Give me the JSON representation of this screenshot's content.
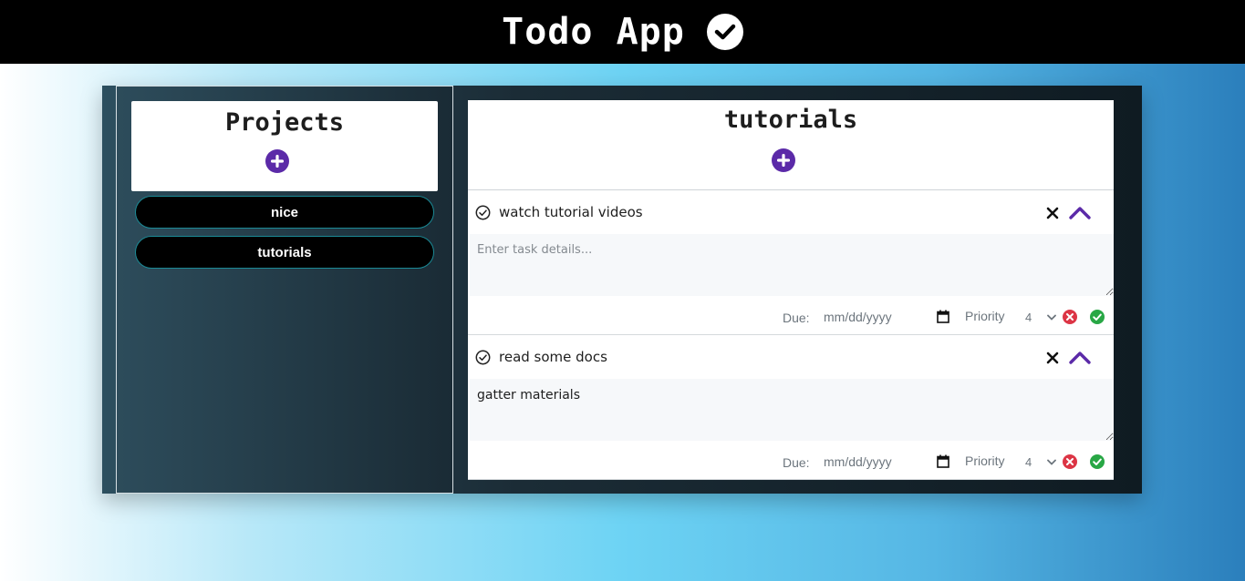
{
  "app": {
    "title": "Todo App"
  },
  "sidebar": {
    "title": "Projects",
    "projects": [
      {
        "label": "nice"
      },
      {
        "label": "tutorials"
      }
    ]
  },
  "main": {
    "title": "tutorials",
    "tasks": [
      {
        "name": "watch tutorial videos",
        "details": "",
        "details_placeholder": "Enter task details...",
        "due_label": "Due:",
        "due_placeholder": "mm/dd/yyyy",
        "priority_label": "Priority",
        "priority": "4"
      },
      {
        "name": "read some docs",
        "details": "gatter materials",
        "details_placeholder": "Enter task details...",
        "due_label": "Due:",
        "due_placeholder": "mm/dd/yyyy",
        "priority_label": "Priority",
        "priority": "4"
      }
    ]
  },
  "colors": {
    "accent": "#5b2aa8",
    "cancel": "#dc3545",
    "confirm": "#28a745"
  }
}
